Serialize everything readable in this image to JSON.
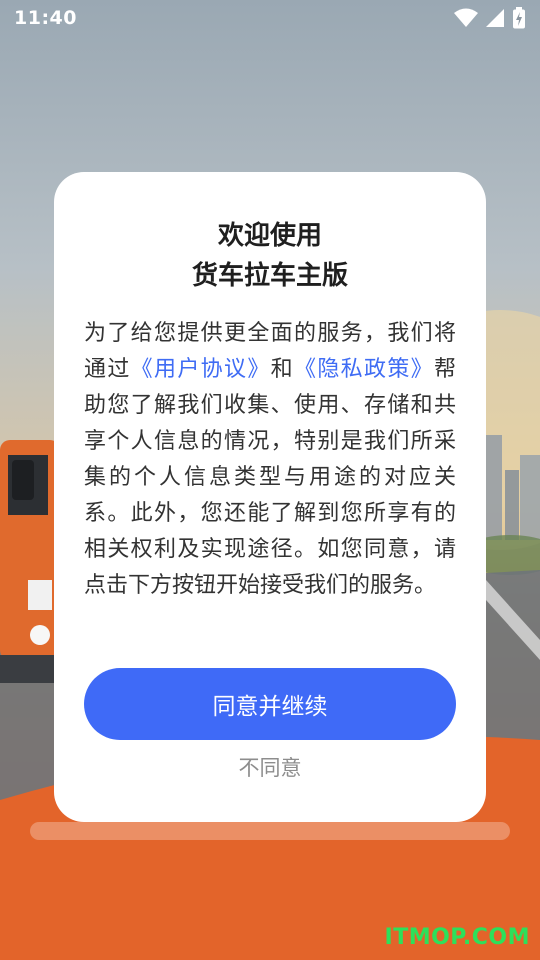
{
  "status_bar": {
    "time": "11:40"
  },
  "dialog": {
    "title_line1": "欢迎使用",
    "title_line2": "货车拉车主版",
    "text_before_user_agreement": "为了给您提供更全面的服务，我们将通过",
    "user_agreement_link": "《用户协议》",
    "text_and": "和",
    "privacy_policy_link": "《隐私政策》",
    "text_after": "帮助您了解我们收集、使用、存储和共享个人信息的情况，特别是我们所采集的个人信息类型与用途的对应关系。此外，您还能了解到您所享有的相关权利及实现途径。如您同意，请点击下方按钮开始接受我们的服务。",
    "agree_button": "同意并继续",
    "disagree_button": "不同意"
  },
  "watermark": "ITMOP.COM",
  "colors": {
    "accent": "#3f6af7",
    "link": "#3f6cf4",
    "watermark": "#2de05a"
  }
}
